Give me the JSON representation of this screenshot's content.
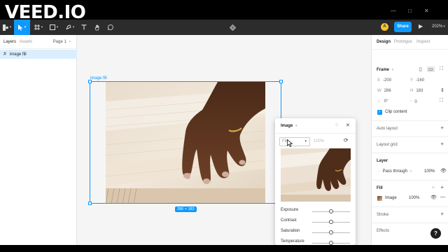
{
  "watermark": "VEED.IO",
  "titlebar": {
    "minimize": "—",
    "maximize": "□",
    "close": "✕"
  },
  "toolbar": {
    "share_label": "Share",
    "avatar_letter": "A",
    "zoom": "202%",
    "accent": "#0d99ff"
  },
  "left_panel": {
    "tabs": [
      "Layers",
      "Assets"
    ],
    "page": "Page 1",
    "layers": [
      {
        "name": "image fill",
        "selected": true
      }
    ]
  },
  "canvas": {
    "frame_label": "image fill",
    "size_badge": "286 × 183"
  },
  "image_popover": {
    "title": "Image",
    "mode": "Fill",
    "opacity": "100%",
    "adjustments": [
      {
        "label": "Exposure",
        "value": 0.5
      },
      {
        "label": "Contrast",
        "value": 0.5
      },
      {
        "label": "Saturation",
        "value": 0.5
      },
      {
        "label": "Temperature",
        "value": 0.5
      }
    ]
  },
  "right_panel": {
    "tabs": [
      "Design",
      "Prototype",
      "Inspect"
    ],
    "frame_title": "Frame",
    "x": "-200",
    "y": "-160",
    "w": "286",
    "h": "183",
    "rotation": "0°",
    "radius": "0",
    "clip_content": "Clip content",
    "auto_layout": "Auto layout",
    "layout_grid": "Layout grid",
    "layer_title": "Layer",
    "blend_mode": "Pass through",
    "layer_opacity": "100%",
    "fill_title": "Fill",
    "fill_type": "Image",
    "fill_opacity": "100%",
    "stroke_title": "Stroke",
    "effects_title": "Effects"
  },
  "help_label": "?"
}
